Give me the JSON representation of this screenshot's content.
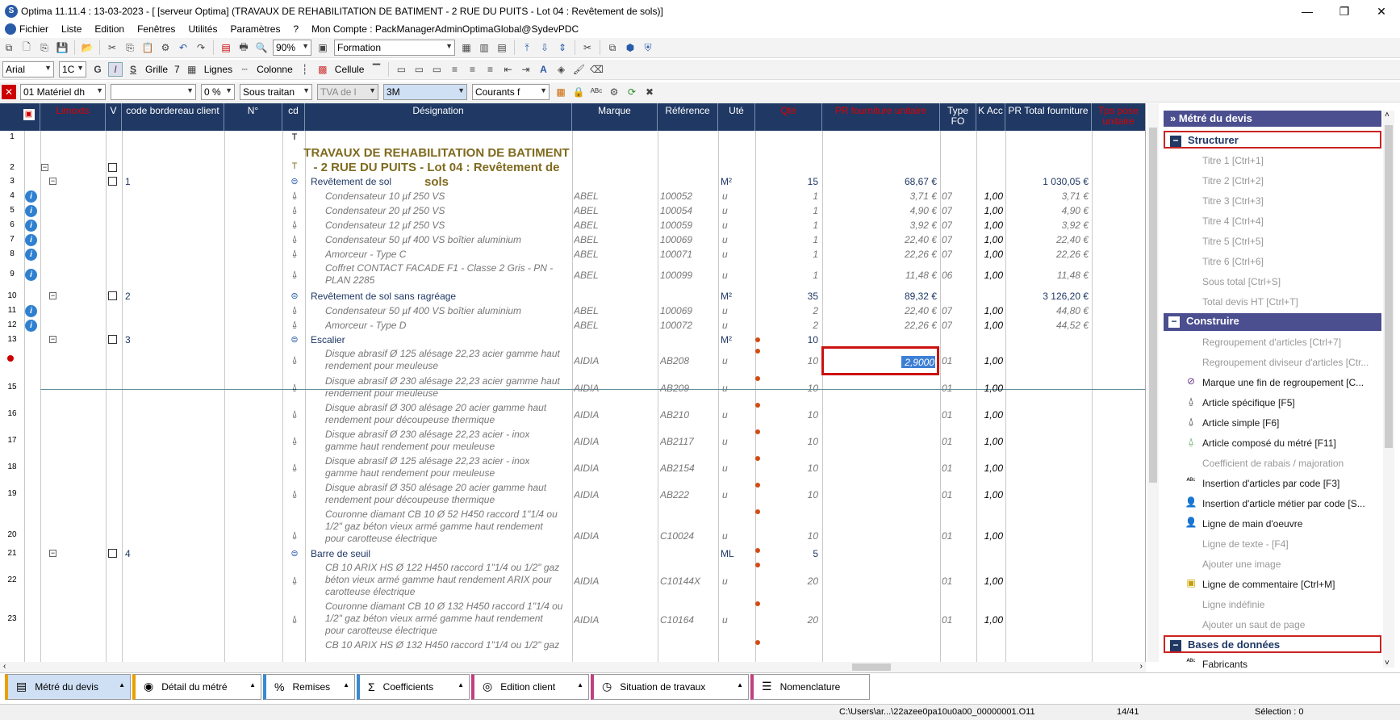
{
  "window": {
    "title": "Optima 11.11.4 : 13-03-2023 - [ [serveur Optima] (TRAVAUX DE REHABILITATION DE BATIMENT - 2 RUE DU PUITS - Lot 04 : Revêtement de sols)]",
    "logo": "S"
  },
  "menu": {
    "items": [
      "Fichier",
      "Liste",
      "Edition",
      "Fenêtres",
      "Utilités",
      "Paramètres",
      "?"
    ],
    "account": "Mon Compte : PackManagerAdminOptimaGlobal@SydevPDC"
  },
  "toolbar1": {
    "zoom": "90%",
    "mode": "Formation"
  },
  "toolbar2": {
    "font": "Arial",
    "size": "1C",
    "bold": "G",
    "italic": "I",
    "strike": "S",
    "grille_label": "Grille",
    "grille_val": "7",
    "lignes": "Lignes",
    "colonne": "Colonne",
    "cellule": "Cellule"
  },
  "toolbar3": {
    "c1": "01  Matériel dh",
    "c2": "",
    "c3": "0 %",
    "c4": "Sous traitan",
    "c5": "TVA de l",
    "c6": "3M",
    "c7": "Courants f"
  },
  "headers": {
    "limoxts": "Limoxts",
    "v": "V",
    "code": "code bordereau client",
    "num": "N°",
    "cd": "cd",
    "designation": "Désignation",
    "marque": "Marque",
    "reference": "Référence",
    "ute": "Uté",
    "qte": "Qté",
    "pr_unit": "PR fourniture unitaire",
    "type": "Type FO",
    "kacc": "K Acc",
    "pr_total": "PR Total fourniture",
    "tps": "Tps pose unitaire"
  },
  "title_block": {
    "line": "TRAVAUX DE REHABILITATION DE BATIMENT - 2 RUE DU PUITS  - Lot 04 : Revêtement de sols"
  },
  "rows": [
    {
      "n": "3",
      "code": "1",
      "des": "Revêtement de sol",
      "ute": "M²",
      "qte": "15",
      "pu": "68,67 €",
      "pt": "1 030,05 €"
    },
    {
      "n": "4",
      "des": "Condensateur 10 µf 250 VS",
      "marque": "ABEL",
      "ref": "100052",
      "ute": "u",
      "qte": "1",
      "pu": "3,71 €",
      "type": "07",
      "k": "1,00",
      "pt": "3,71 €"
    },
    {
      "n": "5",
      "des": "Condensateur 20 µf 250 VS",
      "marque": "ABEL",
      "ref": "100054",
      "ute": "u",
      "qte": "1",
      "pu": "4,90 €",
      "type": "07",
      "k": "1,00",
      "pt": "4,90 €"
    },
    {
      "n": "6",
      "des": "Condensateur 12 µf 250 VS",
      "marque": "ABEL",
      "ref": "100059",
      "ute": "u",
      "qte": "1",
      "pu": "3,92 €",
      "type": "07",
      "k": "1,00",
      "pt": "3,92 €"
    },
    {
      "n": "7",
      "des": "Condensateur 50 µf 400 VS boîtier aluminium",
      "marque": "ABEL",
      "ref": "100069",
      "ute": "u",
      "qte": "1",
      "pu": "22,40 €",
      "type": "07",
      "k": "1,00",
      "pt": "22,40 €"
    },
    {
      "n": "8",
      "des": "Amorceur  - Type C",
      "marque": "ABEL",
      "ref": "100071",
      "ute": "u",
      "qte": "1",
      "pu": "22,26 €",
      "type": "07",
      "k": "1,00",
      "pt": "22,26 €"
    },
    {
      "n": "9",
      "des1": "Coffret CONTACT FACADE F1 - Classe 2 Gris - PN -",
      "des2": "PLAN 2285",
      "marque": "ABEL",
      "ref": "100099",
      "ute": "u",
      "qte": "1",
      "pu": "11,48 €",
      "type": "06",
      "k": "1,00",
      "pt": "11,48 €"
    },
    {
      "n": "10",
      "code": "2",
      "des": "Revêtement de sol sans ragréage",
      "ute": "M²",
      "qte": "35",
      "pu": "89,32 €",
      "pt": "3 126,20 €"
    },
    {
      "n": "11",
      "des": "Condensateur 50 µf 400 VS boîtier aluminium",
      "marque": "ABEL",
      "ref": "100069",
      "ute": "u",
      "qte": "2",
      "pu": "22,40 €",
      "type": "07",
      "k": "1,00",
      "pt": "44,80 €"
    },
    {
      "n": "12",
      "des": "Amorceur  - Type D",
      "marque": "ABEL",
      "ref": "100072",
      "ute": "u",
      "qte": "2",
      "pu": "22,26 €",
      "type": "07",
      "k": "1,00",
      "pt": "44,52 €"
    },
    {
      "n": "13",
      "code": "3",
      "des": "Escalier",
      "ute": "M²",
      "qte": "10"
    },
    {
      "n": "",
      "des1": "Disque abrasif Ø 125 alésage 22,23 acier gamme haut",
      "des2": "rendement pour meuleuse",
      "marque": "AIDIA",
      "ref": "AB208",
      "ute": "u",
      "qte": "10",
      "pu": "2,9000",
      "type": "01",
      "k": "1,00"
    },
    {
      "n": "15",
      "des1": "Disque abrasif Ø 230 alésage 22,23 acier gamme haut",
      "des2": "rendement pour meuleuse",
      "marque": "AIDIA",
      "ref": "AB209",
      "ute": "u",
      "qte": "10",
      "type": "01",
      "k": "1,00"
    },
    {
      "n": "16",
      "des1": "Disque abrasif Ø 300 alésage 20 acier gamme haut",
      "des2": "rendement pour découpeuse thermique",
      "marque": "AIDIA",
      "ref": "AB210",
      "ute": "u",
      "qte": "10",
      "type": "01",
      "k": "1,00"
    },
    {
      "n": "17",
      "des1": "Disque abrasif Ø 230 alésage 22,23 acier - inox",
      "des2": "gamme haut rendement pour meuleuse",
      "marque": "AIDIA",
      "ref": "AB2117",
      "ute": "u",
      "qte": "10",
      "type": "01",
      "k": "1,00"
    },
    {
      "n": "18",
      "des1": "Disque abrasif Ø 125 alésage 22,23 acier - inox",
      "des2": "gamme haut rendement pour meuleuse",
      "marque": "AIDIA",
      "ref": "AB2154",
      "ute": "u",
      "qte": "10",
      "type": "01",
      "k": "1,00"
    },
    {
      "n": "19",
      "des1": "Disque abrasif Ø 350 alésage 20 acier gamme haut",
      "des2": "rendement pour découpeuse thermique",
      "marque": "AIDIA",
      "ref": "AB222",
      "ute": "u",
      "qte": "10",
      "type": "01",
      "k": "1,00"
    },
    {
      "n": "20",
      "des1": "Couronne diamant CB 10 Ø 52 H450 raccord 1\"1/4 ou",
      "des2": "1/2\" gaz béton vieux armé gamme haut rendement",
      "des3": "pour carotteuse électrique",
      "marque": "AIDIA",
      "ref": "C10024",
      "ute": "u",
      "qte": "10",
      "type": "01",
      "k": "1,00"
    },
    {
      "n": "21",
      "code": "4",
      "des": "Barre de seuil",
      "ute": "ML",
      "qte": "5"
    },
    {
      "n": "22",
      "des1": "CB 10 ARIX HS Ø 122 H450 raccord 1\"1/4 ou 1/2\" gaz",
      "des2": "béton vieux armé gamme haut rendement ARIX pour",
      "des3": "carotteuse électrique",
      "marque": "AIDIA",
      "ref": "C10144X",
      "ute": "u",
      "qte": "20",
      "type": "01",
      "k": "1,00"
    },
    {
      "n": "23",
      "des1": "Couronne diamant CB 10 Ø 132 H450 raccord 1\"1/4 ou",
      "des2": "1/2\" gaz béton vieux armé gamme haut rendement",
      "des3": "pour carotteuse électrique",
      "marque": "AIDIA",
      "ref": "C10164",
      "ute": "u",
      "qte": "20",
      "type": "01",
      "k": "1,00"
    },
    {
      "n": "",
      "des1": "CB 10 ARIX HS Ø 132 H450 raccord 1\"1/4 ou 1/2\" gaz"
    }
  ],
  "panel": {
    "title": "Métré du devis",
    "structurer": "Structurer",
    "structurer_items": [
      "Titre 1 [Ctrl+1]",
      "Titre 2 [Ctrl+2]",
      "Titre 3 [Ctrl+3]",
      "Titre 4 [Ctrl+4]",
      "Titre 5 [Ctrl+5]",
      "Titre 6 [Ctrl+6]",
      "Sous total [Ctrl+S]",
      "Total devis HT [Ctrl+T]"
    ],
    "construire": "Construire",
    "construire_items": [
      "Regroupement d'articles  [Ctrl+7]",
      "Regroupement diviseur d'articles [Ctr...",
      "Marque une fin de regroupement  [C...",
      "Article spécifique [F5]",
      "Article simple [F6]",
      "Article composé du métré [F11]",
      "Coefficient de rabais / majoration",
      "Insertion d'articles par code [F3]",
      "Insertion d'article métier par code [S...",
      "Ligne de main d'oeuvre",
      "Ligne de texte - [F4]",
      "Ajouter une image",
      "Ligne de commentaire [Ctrl+M]",
      "Ligne indéfinie",
      "Ajouter un saut de page"
    ],
    "bases": "Bases de données",
    "bases_items": [
      "Fabricants"
    ]
  },
  "tabs": [
    "Métré du devis",
    "Détail du métré",
    "Remises",
    "Coefficients",
    "Edition client",
    "Situation de travaux",
    "Nomenclature"
  ],
  "status": {
    "path": "C:\\Users\\ar...\\22azee0pa10u0a00_00000001.O11",
    "pos": "14/41",
    "sel": "Sélection : 0"
  }
}
